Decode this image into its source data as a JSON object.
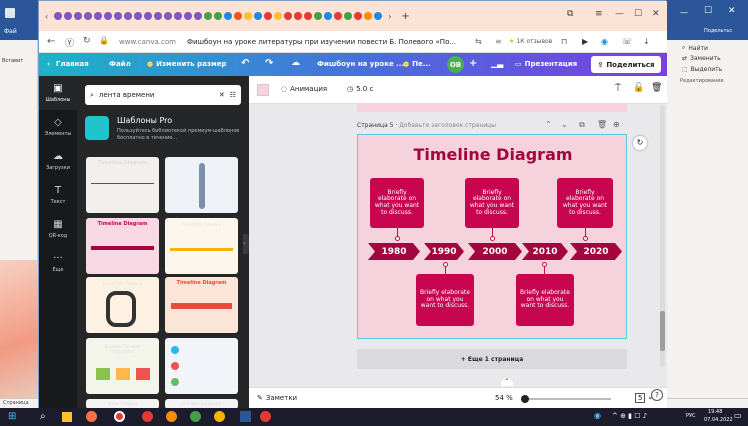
{
  "browser": {
    "address": "www.canva.com",
    "page_title": "Фишбоун на уроке литературы при изучении повести Б. Полевого «По...",
    "reviews": "1К отзывов"
  },
  "word": {
    "file_label": "Фай",
    "paste_label": "Вставит",
    "search_label": "Подельтьс",
    "find_label": "Найти",
    "replace_label": "Заменить",
    "select_label": "Выделить",
    "editing_label": "Редактирование",
    "status_label": "Страница"
  },
  "canva": {
    "home": "Главная",
    "file": "Файл",
    "resize": "Изменить размер",
    "doc_title": "Фишбоун на уроке ...",
    "doc_menu": "Пе...",
    "avatar": "ОВ",
    "present": "Презентация",
    "share": "Поделиться"
  },
  "rail": {
    "items": [
      "Шаблоны",
      "Элементы",
      "Загрузки",
      "Текст",
      "QR-код",
      "Еще"
    ]
  },
  "panel": {
    "search_value": "лента времени",
    "pro_title": "Шаблоны Pro",
    "pro_text": "Пользуйтесь библиотекой премиум-шаблонов бесплатно в течение...",
    "thumbs": [
      "Timeline Diagram",
      "",
      "Timeline Diagram",
      "Fiscal Path Timeline",
      "Fiscal Path Timeline",
      "Timeline Diagram",
      "Business Timeline Infographic",
      "",
      "Arrow Timeline",
      "Fire Path Horizontal"
    ]
  },
  "toolbar": {
    "animation": "Анимация",
    "duration": "5.0 с"
  },
  "page": {
    "label": "Страница 5",
    "add_title": "Добавьте заголовок страницы",
    "add_page": "+ Еще 1 страница"
  },
  "diagram": {
    "title": "Timeline Diagram",
    "card_text": "Briefly elaborate on what you want to discuss.",
    "years": [
      "1980",
      "1990",
      "2000",
      "2010",
      "2020"
    ]
  },
  "bottom": {
    "notes": "Заметки",
    "zoom": "54 %",
    "pages": "5",
    "help": "?"
  },
  "taskbar": {
    "lang": "РУС",
    "time": "19:48",
    "date": "07.04.2022"
  },
  "colors": {
    "accent": "#c8054f",
    "canvas_bg": "#f6d3dc",
    "rail_bg": "#18191b"
  }
}
